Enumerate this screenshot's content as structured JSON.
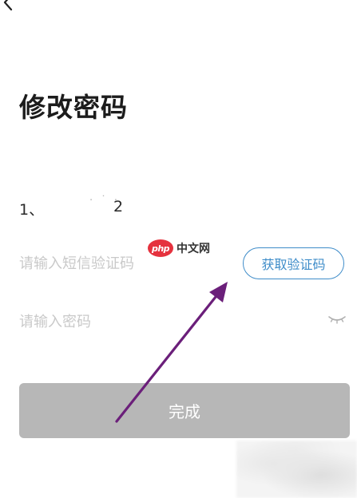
{
  "header": {
    "back_icon": "chevron-left-icon"
  },
  "page": {
    "title": "修改密码"
  },
  "phone": {
    "prefix": "1、",
    "masked": "· ˙ ·",
    "suffix": "2"
  },
  "sms_code": {
    "placeholder": "请输入短信验证码",
    "value": "",
    "get_code_label": "获取验证码"
  },
  "password": {
    "placeholder": "请输入密码",
    "value": "",
    "visibility_icon": "eye-closed-icon"
  },
  "submit": {
    "label": "完成"
  },
  "watermark": {
    "logo_text": "php",
    "site_text": "中文网"
  },
  "colors": {
    "accent": "#3e8cc9",
    "button_disabled": "#b7b7b7",
    "annotation_arrow": "#6b1f7a",
    "placeholder": "#c9c9c9"
  }
}
